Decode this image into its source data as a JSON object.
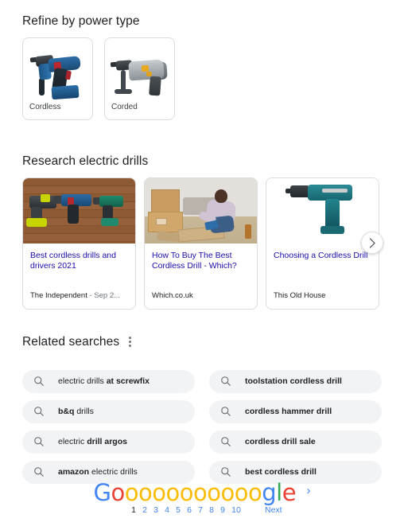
{
  "refine": {
    "heading": "Refine by power type",
    "cards": [
      {
        "label": "Cordless",
        "image": "cordless-drill-photo"
      },
      {
        "label": "Corded",
        "image": "corded-drill-photo"
      }
    ]
  },
  "research": {
    "heading": "Research electric drills",
    "next_button_icon": "chevron-right-icon",
    "cards": [
      {
        "title": "Best cordless drills and drivers 2021",
        "source": "The Independent",
        "date": "- Sep 2...",
        "image": "three-cordless-drills-on-wood-photo"
      },
      {
        "title": "How To Buy The Best Cordless Drill - Which?",
        "source": "Which.co.uk",
        "date": "",
        "image": "man-using-drill-with-boxes-photo"
      },
      {
        "title": "Choosing a Cordless Drill",
        "source": "This Old House",
        "date": "",
        "image": "teal-corded-drill-photo"
      }
    ]
  },
  "related": {
    "heading": "Related searches",
    "menu_icon": "more-options-vertical-dots-icon",
    "search_icon": "magnifying-glass-icon",
    "items": [
      {
        "plain_prefix": "electric drills ",
        "bold": "at screwfix",
        "plain_suffix": ""
      },
      {
        "plain_prefix": "",
        "bold": "b&q",
        "plain_suffix": " drills"
      },
      {
        "plain_prefix": "electric ",
        "bold": "drill argos",
        "plain_suffix": ""
      },
      {
        "plain_prefix": "",
        "bold": "amazon",
        "plain_suffix": " electric drills"
      },
      {
        "plain_prefix": "",
        "bold": "toolstation cordless drill",
        "plain_suffix": ""
      },
      {
        "plain_prefix": "",
        "bold": "cordless hammer drill",
        "plain_suffix": ""
      },
      {
        "plain_prefix": "",
        "bold": "cordless drill sale",
        "plain_suffix": ""
      },
      {
        "plain_prefix": "",
        "bold": "best cordless drill",
        "plain_suffix": ""
      }
    ]
  },
  "pagination": {
    "logo_letters": [
      {
        "char": "G",
        "color_name": "blue"
      },
      {
        "char": "o",
        "color_name": "red"
      },
      {
        "char": "o",
        "color_name": "yellow"
      },
      {
        "char": "o",
        "color_name": "yellow"
      },
      {
        "char": "o",
        "color_name": "yellow"
      },
      {
        "char": "o",
        "color_name": "yellow"
      },
      {
        "char": "o",
        "color_name": "yellow"
      },
      {
        "char": "o",
        "color_name": "yellow"
      },
      {
        "char": "o",
        "color_name": "yellow"
      },
      {
        "char": "o",
        "color_name": "yellow"
      },
      {
        "char": "o",
        "color_name": "yellow"
      },
      {
        "char": "o",
        "color_name": "yellow"
      },
      {
        "char": "g",
        "color_name": "blue"
      },
      {
        "char": "l",
        "color_name": "green"
      },
      {
        "char": "e",
        "color_name": "red"
      }
    ],
    "arrow_icon": "chevron-right-icon",
    "current_page": "1",
    "pages": [
      "2",
      "3",
      "4",
      "5",
      "6",
      "7",
      "8",
      "9",
      "10"
    ],
    "next_label": "Next"
  },
  "colors": {
    "link": "#1a0dab",
    "google_blue": "#4285f4",
    "google_red": "#ea4335",
    "google_yellow": "#fbbc05",
    "google_green": "#34a853",
    "pill_bg": "#f1f3f4",
    "text_primary": "#202124",
    "text_secondary": "#70757a",
    "border": "#dadce0"
  }
}
